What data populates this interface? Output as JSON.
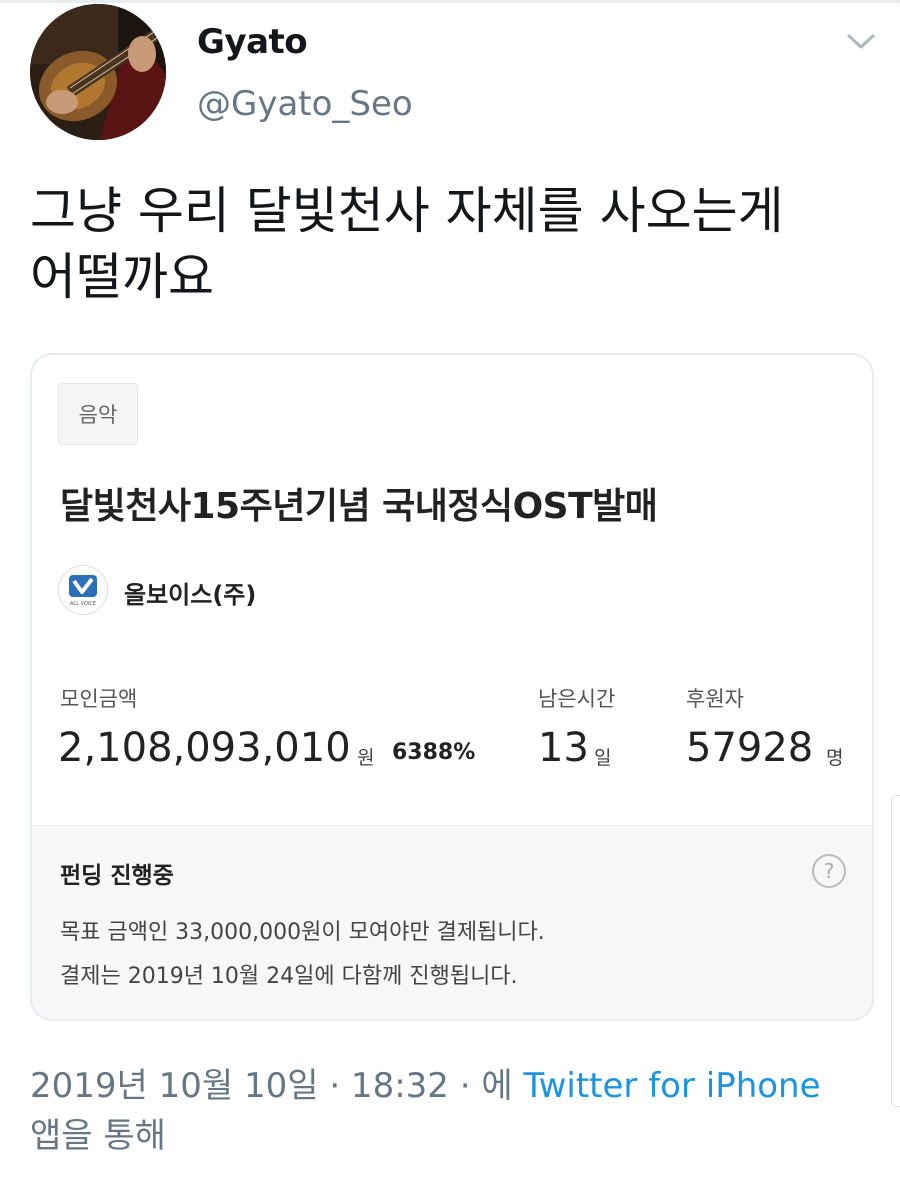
{
  "tweet": {
    "author": {
      "display_name": "Gyato",
      "handle": "@Gyato_Seo",
      "avatar_icon": "guitar-player-photo"
    },
    "menu_icon": "chevron-down-icon",
    "text_line_1": "그냥 우리 달빛천사 자체를 사오는게",
    "text_line_2": "어떨까요",
    "timestamp": "2019년 10월 10일 · 18:32 · 에",
    "source": "Twitter for iPhone",
    "source_suffix": "앱을 통해"
  },
  "card": {
    "category": "음악",
    "title": "달빛천사15주년기념 국내정식OST발매",
    "maker": {
      "name": "올보이스(주)",
      "logo_text": "ALL VOICE"
    },
    "stats": {
      "amount_label": "모인금액",
      "amount_value": "2,108,093,010",
      "amount_unit": "원",
      "amount_percent": "6388%",
      "time_label": "남은시간",
      "time_value": "13",
      "time_unit": "일",
      "supporters_label": "후원자",
      "supporters_value": "57928",
      "supporters_unit": "명"
    },
    "funding": {
      "status": "펀딩 진행중",
      "help_symbol": "?",
      "line_1": "목표 금액인 33,000,000원이 모여야만 결제됩니다.",
      "line_2": "결제는 2019년 10월 24일에 다함께 진행됩니다."
    }
  },
  "colors": {
    "link": "#1b95e0",
    "secondary_text": "#657786",
    "primary_text": "#14171a",
    "card_border": "#e6ecf0",
    "funding_bg": "#f7f7f7"
  }
}
